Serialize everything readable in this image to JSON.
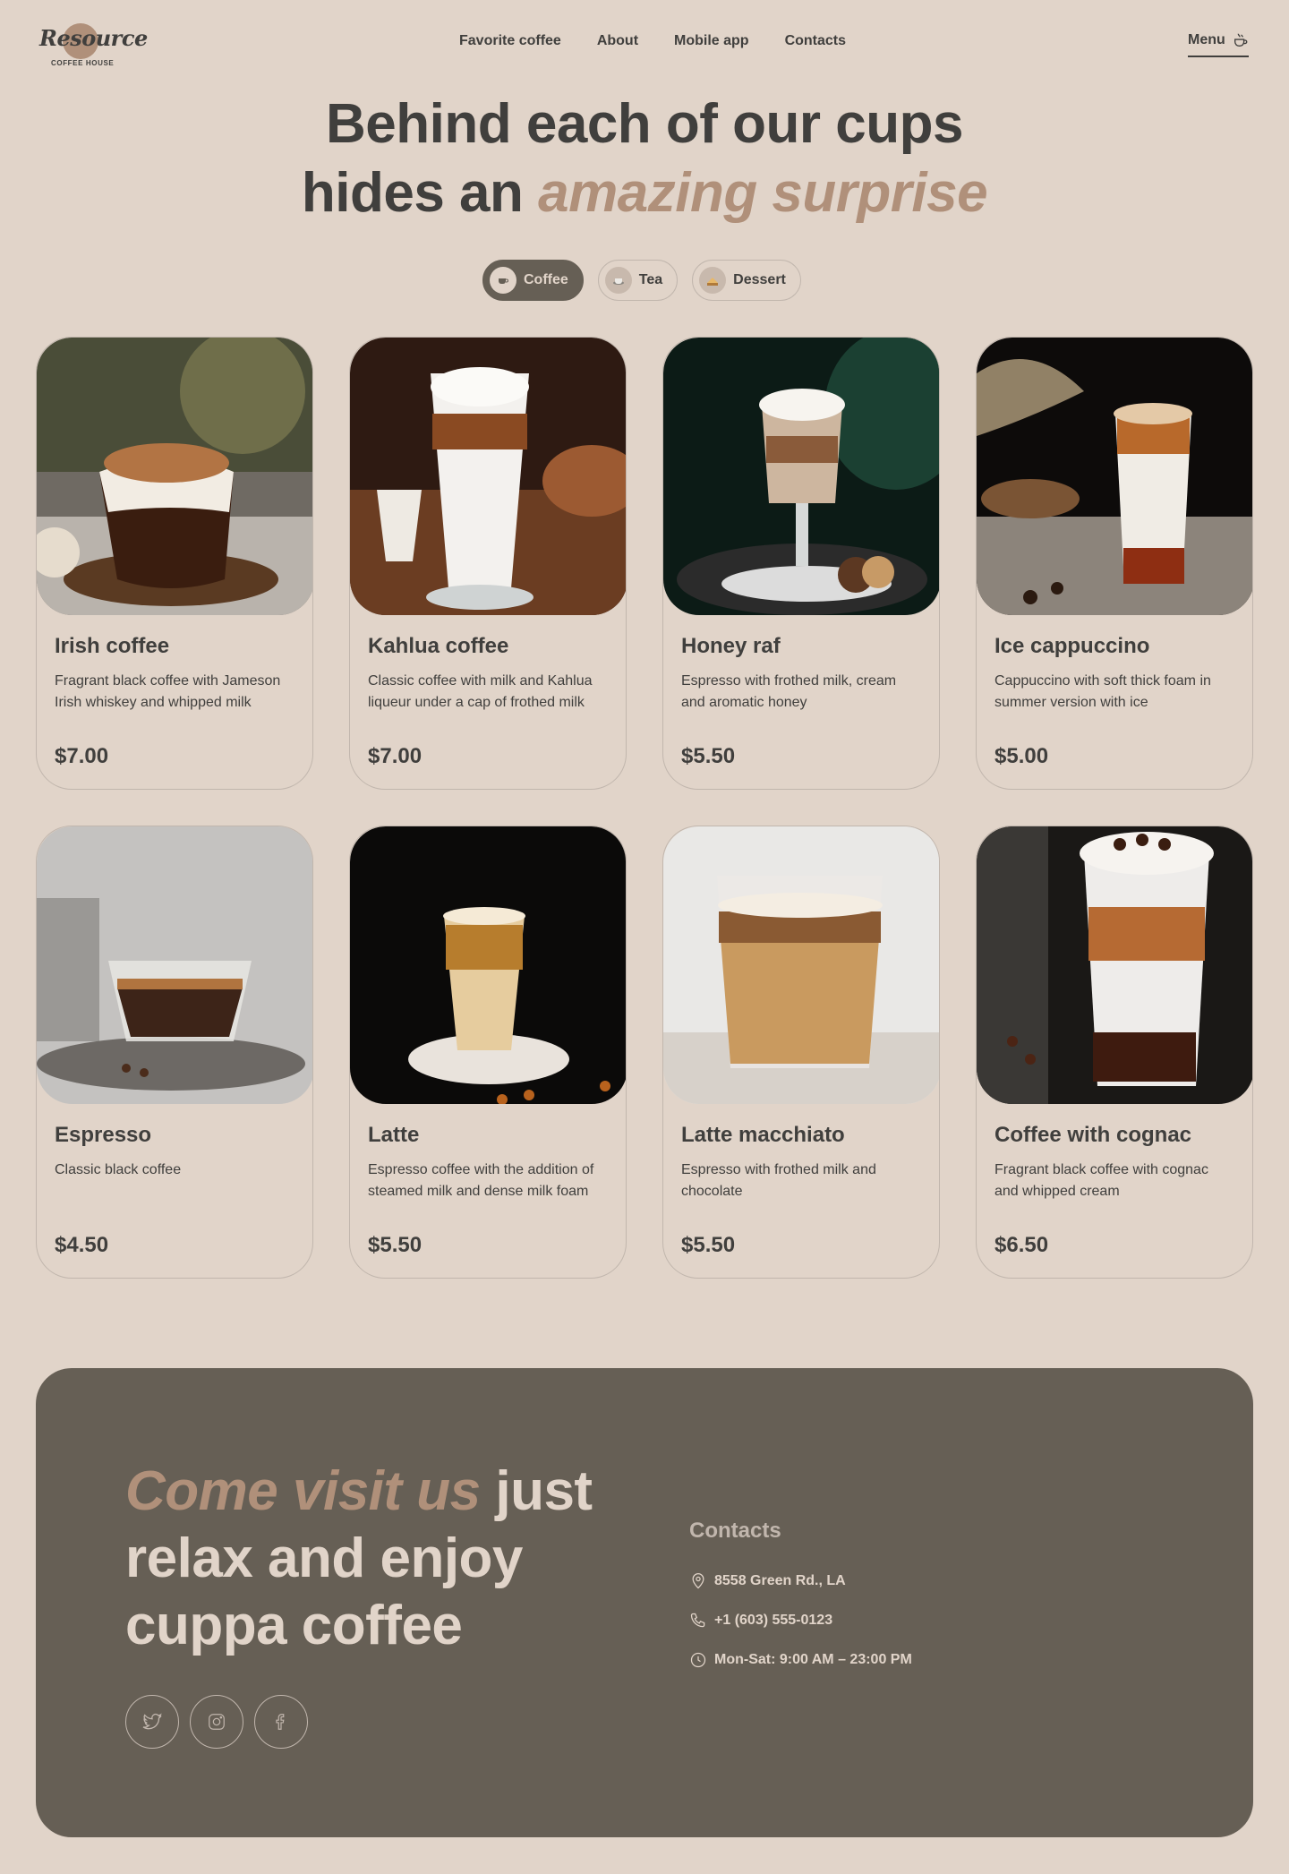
{
  "header": {
    "logo_text": "Resource",
    "logo_sub": "COFFEE HOUSE",
    "nav": [
      "Favorite coffee",
      "About",
      "Mobile app",
      "Contacts"
    ],
    "menu_label": "Menu"
  },
  "hero": {
    "line1": "Behind each of our cups",
    "line2_plain": "hides an ",
    "line2_accent": "amazing surprise"
  },
  "tabs": [
    {
      "label": "Coffee",
      "icon": "coffee-cup-icon",
      "active": true
    },
    {
      "label": "Tea",
      "icon": "tea-cup-icon",
      "active": false
    },
    {
      "label": "Dessert",
      "icon": "cake-icon",
      "active": false
    }
  ],
  "products": [
    {
      "name": "Irish coffee",
      "desc": "Fragrant black coffee with Jameson Irish whiskey and whipped milk",
      "price": "$7.00"
    },
    {
      "name": "Kahlua coffee",
      "desc": "Classic coffee with milk and Kahlua liqueur under a cap of frothed milk",
      "price": "$7.00"
    },
    {
      "name": "Honey raf",
      "desc": "Espresso with frothed milk, cream and aromatic honey",
      "price": "$5.50"
    },
    {
      "name": "Ice cappuccino",
      "desc": "Cappuccino with soft thick foam in summer version with ice",
      "price": "$5.00"
    },
    {
      "name": "Espresso",
      "desc": "Classic black coffee",
      "price": "$4.50"
    },
    {
      "name": "Latte",
      "desc": "Espresso coffee with the addition of steamed milk and dense milk foam",
      "price": "$5.50"
    },
    {
      "name": "Latte macchiato",
      "desc": "Espresso with frothed milk and chocolate",
      "price": "$5.50"
    },
    {
      "name": "Coffee with cognac",
      "desc": "Fragrant black coffee with cognac and whipped cream",
      "price": "$6.50"
    }
  ],
  "footer": {
    "heading_accent": "Come visit us",
    "heading_rest": " just relax and enjoy cuppa coffee",
    "contacts_title": "Contacts",
    "address": "8558 Green Rd.,  LA",
    "phone": "+1 (603) 555-0123",
    "hours": "Mon-Sat: 9:00 AM – 23:00 PM",
    "socials": [
      "twitter-icon",
      "instagram-icon",
      "facebook-icon"
    ]
  },
  "colors": {
    "background": "#e1d4c9",
    "text_dark": "#403f3d",
    "accent": "#b0907a",
    "footer_bg": "#665f55",
    "border": "#c1b6ad"
  }
}
